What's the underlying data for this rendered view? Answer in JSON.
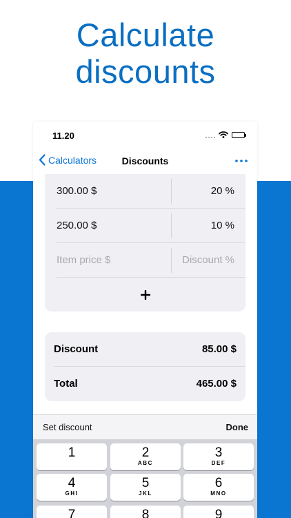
{
  "headline": {
    "line1": "Calculate",
    "line2": "discounts"
  },
  "status_bar": {
    "time": "11.20",
    "signal_icon": "signal-dots-icon",
    "wifi_icon": "wifi-icon",
    "battery_icon": "battery-icon"
  },
  "nav": {
    "back_label": "Calculators",
    "title": "Discounts",
    "more_icon": "ellipsis-icon"
  },
  "items": [
    {
      "price": "300.00 $",
      "discount": "20 %"
    },
    {
      "price": "250.00 $",
      "discount": "10 %"
    }
  ],
  "new_item": {
    "price_placeholder": "Item price $",
    "discount_placeholder": "Discount %"
  },
  "add_icon": "plus-icon",
  "summary": {
    "discount_label": "Discount",
    "discount_value": "85.00 $",
    "total_label": "Total",
    "total_value": "465.00 $"
  },
  "keyboard_toolbar": {
    "label": "Set discount",
    "done_label": "Done"
  },
  "keypad": [
    {
      "digit": "1",
      "letters": ""
    },
    {
      "digit": "2",
      "letters": "ABC"
    },
    {
      "digit": "3",
      "letters": "DEF"
    },
    {
      "digit": "4",
      "letters": "GHI"
    },
    {
      "digit": "5",
      "letters": "JKL"
    },
    {
      "digit": "6",
      "letters": "MNO"
    },
    {
      "digit": "7",
      "letters": ""
    },
    {
      "digit": "8",
      "letters": ""
    },
    {
      "digit": "9",
      "letters": ""
    }
  ],
  "colors": {
    "accent": "#0a76d2",
    "headline": "#0a6fc2",
    "card": "#efeff4",
    "background_band": "#0a76d2"
  }
}
